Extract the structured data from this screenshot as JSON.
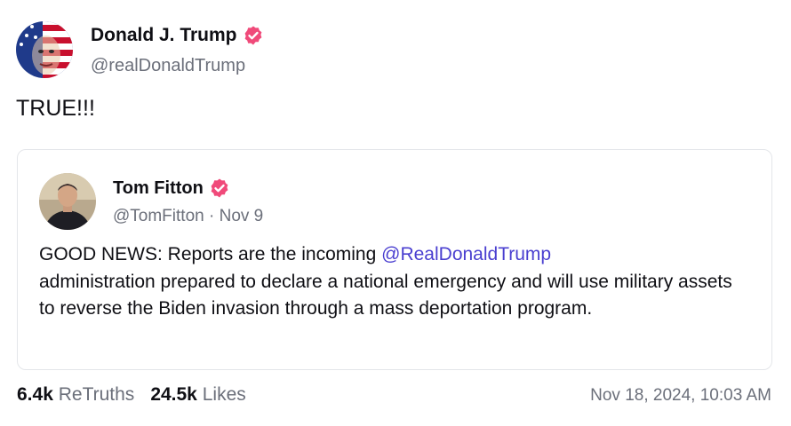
{
  "post": {
    "author": {
      "name": "Donald J. Trump",
      "handle": "@realDonaldTrump",
      "avatar_icon": "flag-face-avatar",
      "verified_icon": "verified-badge-icon"
    },
    "text": "TRUE!!!",
    "quote": {
      "author": {
        "name": "Tom Fitton",
        "handle": "@TomFitton",
        "separator": "·",
        "date": "Nov 9",
        "avatar_icon": "person-avatar",
        "verified_icon": "verified-badge-icon"
      },
      "text_before": "GOOD NEWS: Reports are the incoming ",
      "mention": "@RealDonaldTrump",
      "text_after": " administration prepared to declare a national emergency and will use military assets to reverse the Biden invasion through a mass deportation program."
    },
    "stats": {
      "retruths_count": "6.4k",
      "retruths_label": "ReTruths",
      "likes_count": "24.5k",
      "likes_label": "Likes"
    },
    "timestamp": "Nov 18, 2024, 10:03 AM"
  },
  "colors": {
    "verified": "#f04a7a",
    "mention": "#4a3fd0",
    "muted": "#6b6f7a"
  }
}
